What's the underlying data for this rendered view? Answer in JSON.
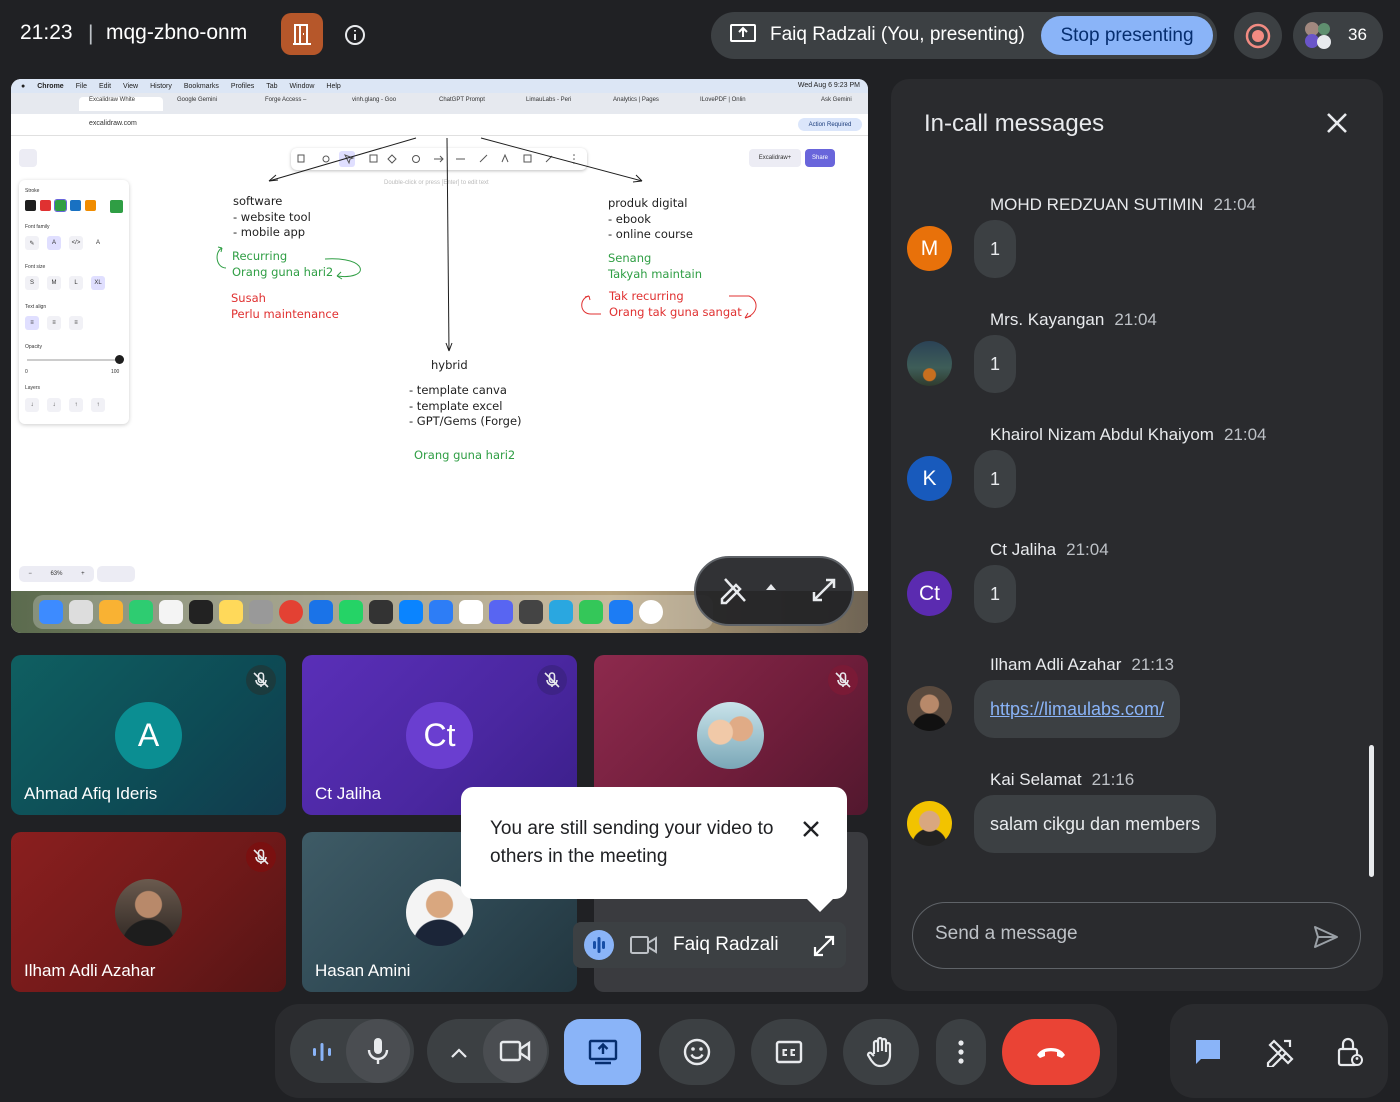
{
  "topbar": {
    "time": "21:23",
    "separator": "|",
    "meeting_code": "mqg-zbno-onm",
    "presenting_text": "Faiq Radzali (You, presenting)",
    "stop_presenting_label": "Stop presenting",
    "participant_count": "36"
  },
  "screen": {
    "menubar": [
      "Chrome",
      "File",
      "Edit",
      "View",
      "History",
      "Bookmarks",
      "Profiles",
      "Tab",
      "Window",
      "Help"
    ],
    "menubar_right": "Wed Aug 6  9:23 PM",
    "tabs": [
      "Excalidraw White",
      "Google Gemini",
      "Forge Access –",
      "vinh.glang - Goo",
      "ChatGPT Prompt",
      "LimauLabs - Peri",
      "Analytics | Pages",
      "ILovePDF | Onlin"
    ],
    "ask_gemini": "Ask Gemini",
    "url": "excalidraw.com",
    "action_required": "Action Required",
    "library_label": "Excalidraw+",
    "share_label": "Share",
    "hint": "Double-click or press [Enter] to edit text",
    "props": {
      "stroke": "Stroke",
      "font_family": "Font family",
      "font_size": "Font size",
      "sizes": [
        "S",
        "M",
        "L",
        "XL"
      ],
      "text_align": "Text align",
      "opacity": "Opacity",
      "opacity_min": "0",
      "opacity_max": "100",
      "layers": "Layers"
    },
    "zoom": "63%",
    "canvas_text": {
      "software": "software\n- website tool\n- mobile app",
      "recurring": "Recurring\nOrang guna hari2",
      "susah": "Susah\nPerlu maintenance",
      "produk": "produk digital\n- ebook\n- online course",
      "senang": "Senang\nTakyah maintain",
      "tak_recurring": "Tak recurring\nOrang tak guna sangat",
      "hybrid": "hybrid",
      "hybrid_list": "- template canva\n- template excel\n- GPT/Gems (Forge)",
      "hybrid_green": "Orang guna hari2"
    }
  },
  "tiles": [
    {
      "name": "Ahmad Afiq Ideris",
      "initial": "A"
    },
    {
      "name": "Ct Jaliha",
      "initial": "Ct"
    },
    {
      "name": ""
    },
    {
      "name": "Ilham Adli Azahar"
    },
    {
      "name": "Hasan Amini"
    }
  ],
  "tooltip": {
    "message": "You are still sending your video to others in the meeting"
  },
  "self_tile": {
    "name": "Faiq Radzali"
  },
  "panel": {
    "title": "In-call messages",
    "messages": [
      {
        "sender": "MOHD REDZUAN SUTIMIN",
        "time": "21:04",
        "text": "1",
        "initial": "M",
        "color": "#e8710a"
      },
      {
        "sender": "Mrs. Kayangan",
        "time": "21:04",
        "text": "1"
      },
      {
        "sender": "Khairol Nizam Abdul Khaiyom",
        "time": "21:04",
        "text": "1",
        "initial": "K",
        "color": "#185abc"
      },
      {
        "sender": "Ct Jaliha",
        "time": "21:04",
        "text": "1",
        "initial": "Ct",
        "color": "#5b2bb0"
      },
      {
        "sender": "Ilham Adli Azahar",
        "time": "21:13",
        "text": "https://limaulabs.com/"
      },
      {
        "sender": "Kai Selamat",
        "time": "21:16",
        "text": "salam cikgu dan members"
      }
    ],
    "send_placeholder": "Send a message"
  },
  "colors": {
    "accent_blue": "#8ab4f8",
    "end_call_red": "#ea4335",
    "background": "#202124",
    "panel": "#2a2b2e"
  },
  "icons": [
    "door-icon",
    "info-icon",
    "present-screen-icon",
    "record-icon",
    "people-icon",
    "mic-off-icon",
    "close-icon",
    "send-icon",
    "audio-level-icon",
    "mic-icon",
    "chevron-up-icon",
    "camera-icon",
    "emoji-icon",
    "captions-icon",
    "hand-icon",
    "more-vert-icon",
    "end-call-icon",
    "chat-icon",
    "tools-icon",
    "host-controls-icon"
  ]
}
